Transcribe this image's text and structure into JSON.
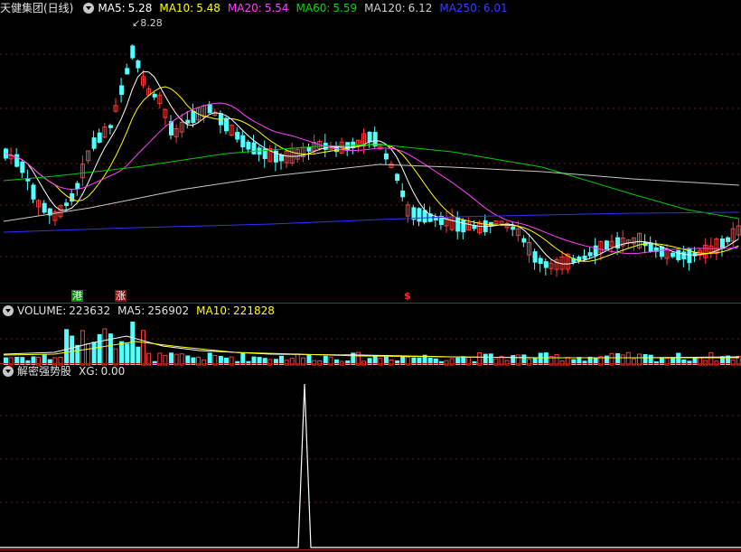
{
  "main": {
    "title": "天健集团(日线)",
    "ma5_label": "MA5:",
    "ma5": "5.28",
    "ma10_label": "MA10:",
    "ma10": "5.48",
    "ma20_label": "MA20:",
    "ma20": "5.54",
    "ma60_label": "MA60:",
    "ma60": "5.59",
    "ma120_label": "MA120:",
    "ma120": "6.12",
    "ma250_label": "MA250:",
    "ma250": "6.01",
    "peak_label": "8.28",
    "signals": [
      "港",
      "涨",
      "$"
    ]
  },
  "volume": {
    "title": "VOLUME:",
    "value": "223632",
    "ma5_label": "MA5:",
    "ma5": "256902",
    "ma10_label": "MA10:",
    "ma10": "221828"
  },
  "indicator": {
    "title": "解密强势股",
    "xg_label": "XG:",
    "xg": "0.00"
  },
  "colors": {
    "up": "#ff3a3a",
    "down": "#54ffff",
    "ma5": "#ffffff",
    "ma10": "#ffff00",
    "ma20": "#ff40ff",
    "ma60": "#00cc00",
    "ma120": "#c8c8c8",
    "ma250": "#3030ff"
  }
}
